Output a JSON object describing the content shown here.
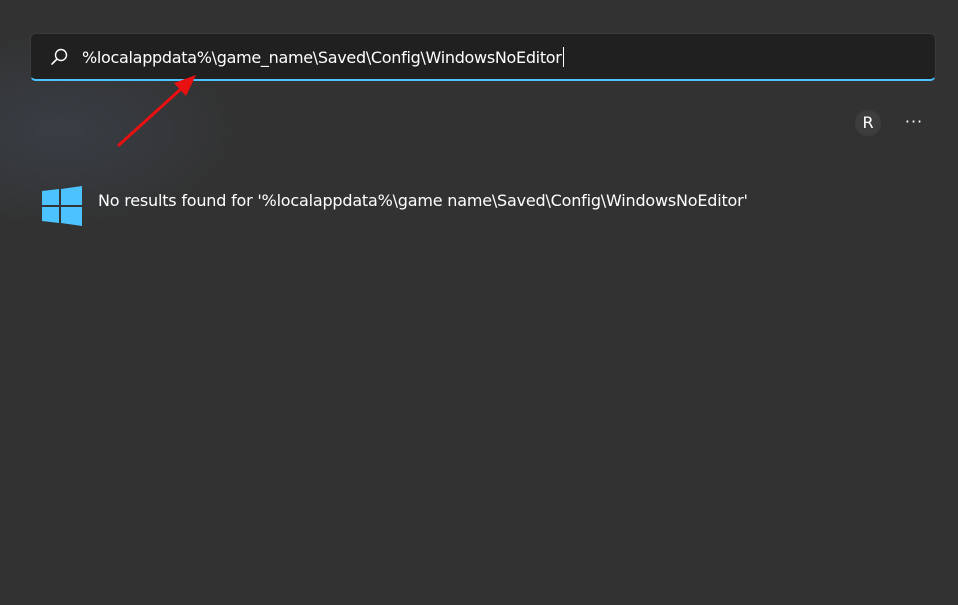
{
  "search": {
    "query": "%localappdata%\\game_name\\Saved\\Config\\WindowsNoEditor",
    "icon": "search-icon"
  },
  "account": {
    "initial": "R"
  },
  "more_options": {
    "label": "···",
    "icon": "more-options-icon"
  },
  "results": {
    "message": "No results found for '%localappdata%\\game name\\Saved\\Config\\WindowsNoEditor'",
    "icon": "windows-logo-icon"
  },
  "colors": {
    "background": "#323232",
    "search_background": "#202020",
    "accent": "#4cc2ff",
    "windows_logo": "#4cc2ff",
    "annotation_arrow": "#e81010",
    "text": "#ffffff"
  }
}
